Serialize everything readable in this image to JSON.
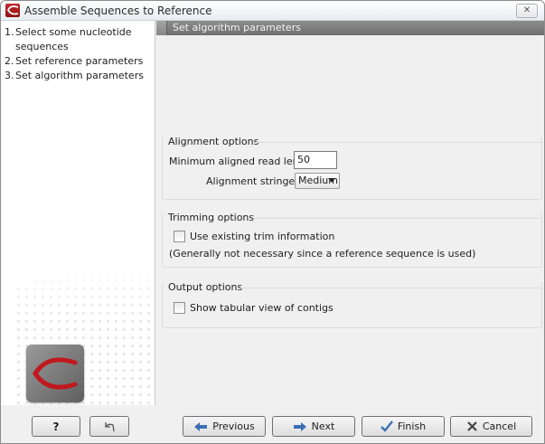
{
  "window": {
    "title": "Assemble Sequences to Reference",
    "close_symbol": "✕",
    "accent": "#b81e1e"
  },
  "steps": [
    {
      "num": "1.",
      "label": "Select some nucleotide sequences"
    },
    {
      "num": "2.",
      "label": "Set reference parameters"
    },
    {
      "num": "3.",
      "label": "Set algorithm parameters"
    }
  ],
  "content": {
    "header": "Set algorithm parameters",
    "alignment": {
      "title": "Alignment options",
      "min_read_label": "Minimum aligned read length:",
      "min_read_value": "50",
      "stringency_label": "Alignment stringency:",
      "stringency_value": "Medium"
    },
    "trimming": {
      "title": "Trimming options",
      "use_trim_label": "Use existing trim information",
      "use_trim_checked": false,
      "note": "(Generally not necessary since a reference sequence is used)"
    },
    "output": {
      "title": "Output options",
      "tabular_label": "Show tabular view of contigs",
      "tabular_checked": false
    }
  },
  "buttons": {
    "help": "?",
    "reset_icon": "reset-arrow-icon",
    "previous": "Previous",
    "next": "Next",
    "finish": "Finish",
    "cancel": "Cancel"
  }
}
